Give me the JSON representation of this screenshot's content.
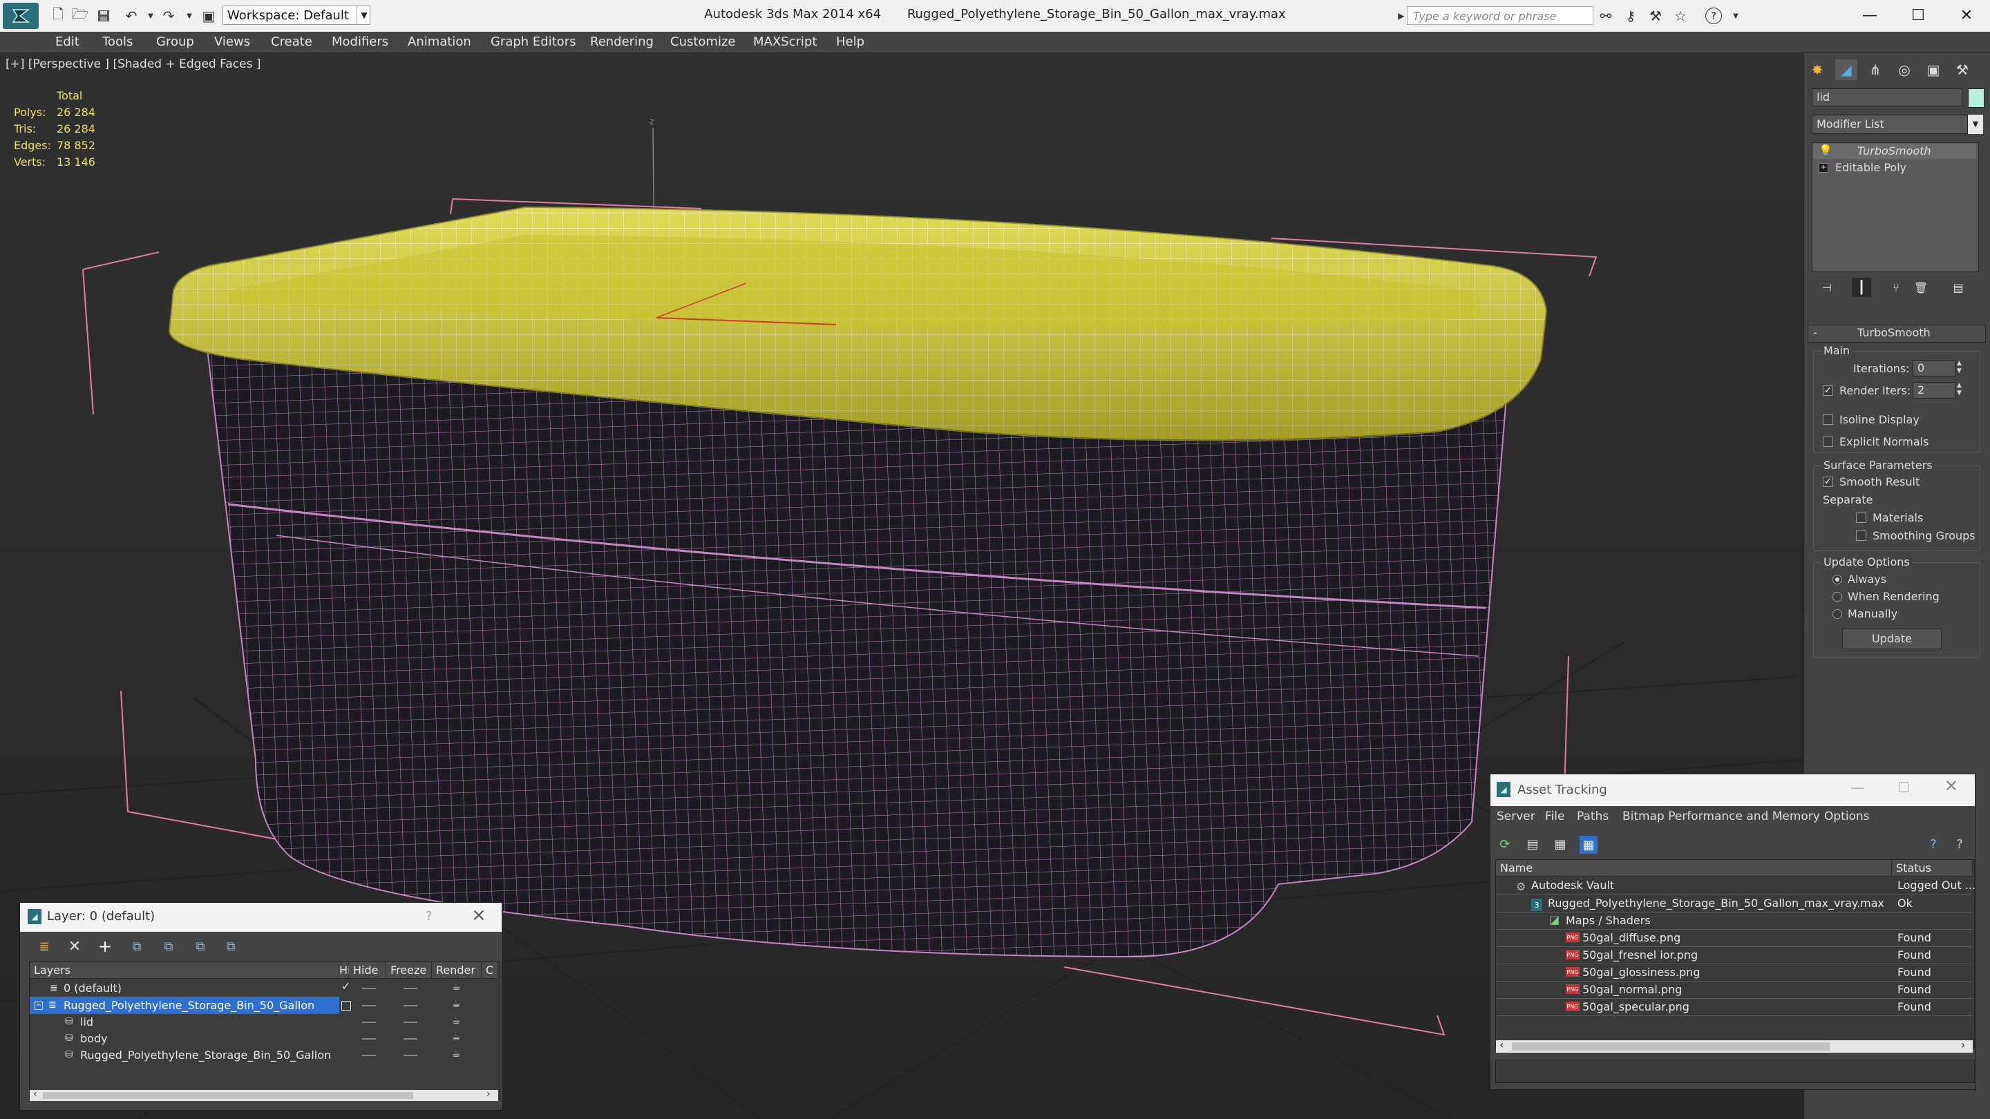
{
  "titlebar": {
    "app_title": "Autodesk 3ds Max  2014 x64",
    "file_title": "Rugged_Polyethylene_Storage_Bin_50_Gallon_max_vray.max",
    "workspace_label": "Workspace: Default",
    "search_placeholder": "Type a keyword or phrase"
  },
  "menu": [
    "Edit",
    "Tools",
    "Group",
    "Views",
    "Create",
    "Modifiers",
    "Animation",
    "Graph Editors",
    "Rendering",
    "Customize",
    "MAXScript",
    "Help"
  ],
  "viewport": {
    "label": "[+] [Perspective ] [Shaded + Edged Faces ]",
    "axis_label": "z",
    "stats": {
      "header": "Total",
      "rows": [
        {
          "label": "Polys:",
          "value": "26 284"
        },
        {
          "label": "Tris:",
          "value": "26 284"
        },
        {
          "label": "Edges:",
          "value": "78 852"
        },
        {
          "label": "Verts:",
          "value": "13 146"
        }
      ]
    }
  },
  "command_panel": {
    "object_name": "lid",
    "modifier_list": "Modifier List",
    "stack": [
      "TurboSmooth",
      "Editable Poly"
    ],
    "rollout_title": "TurboSmooth",
    "rollout_collapse": "-",
    "main_group": "Main",
    "iterations_label": "Iterations:",
    "iterations_value": "0",
    "render_iters_label": "Render Iters:",
    "render_iters_value": "2",
    "render_iters_checked": "✓",
    "isoline_label": "Isoline Display",
    "explicit_normals_label": "Explicit Normals",
    "surface_group": "Surface Parameters",
    "smooth_result_label": "Smooth Result",
    "smooth_result_checked": "✓",
    "separate_label": "Separate",
    "materials_label": "Materials",
    "smoothing_groups_label": "Smoothing Groups",
    "update_group": "Update Options",
    "update_options": [
      "Always",
      "When Rendering",
      "Manually"
    ],
    "update_button": "Update"
  },
  "layer_panel": {
    "title": "Layer: 0 (default)",
    "help": "?",
    "close": "×",
    "columns": [
      "Layers",
      "Hide",
      "Freeze",
      "Render",
      "C"
    ],
    "rows": [
      {
        "name": "0 (default)",
        "indent": 0
      },
      {
        "name": "Rugged_Polyethylene_Storage_Bin_50_Gallon",
        "indent": 0
      },
      {
        "name": "lid",
        "indent": 1
      },
      {
        "name": "body",
        "indent": 1
      },
      {
        "name": "Rugged_Polyethylene_Storage_Bin_50_Gallon",
        "indent": 1
      }
    ]
  },
  "asset_panel": {
    "title": "Asset Tracking",
    "menu": [
      "Server",
      "File",
      "Paths",
      "Bitmap Performance and Memory",
      "Options"
    ],
    "columns": [
      "Name",
      "Status"
    ],
    "rows": [
      {
        "name": "Autodesk Vault",
        "status": "Logged Out ...",
        "indent": 0
      },
      {
        "name": "Rugged_Polyethylene_Storage_Bin_50_Gallon_max_vray.max",
        "status": "Ok",
        "indent": 1
      },
      {
        "name": "Maps / Shaders",
        "status": "",
        "indent": 2
      },
      {
        "name": "50gal_diffuse.png",
        "status": "Found",
        "indent": 3
      },
      {
        "name": "50gal_fresnel ior.png",
        "status": "Found",
        "indent": 3
      },
      {
        "name": "50gal_glossiness.png",
        "status": "Found",
        "indent": 3
      },
      {
        "name": "50gal_normal.png",
        "status": "Found",
        "indent": 3
      },
      {
        "name": "50gal_specular.png",
        "status": "Found",
        "indent": 3
      }
    ],
    "png_badge": "PNG"
  },
  "colors": {
    "lid_yellow": "#d8d231",
    "wire_pink": "#c486c4",
    "selection_blue": "#2e6fd0",
    "stats_yellow": "#f0e060"
  }
}
